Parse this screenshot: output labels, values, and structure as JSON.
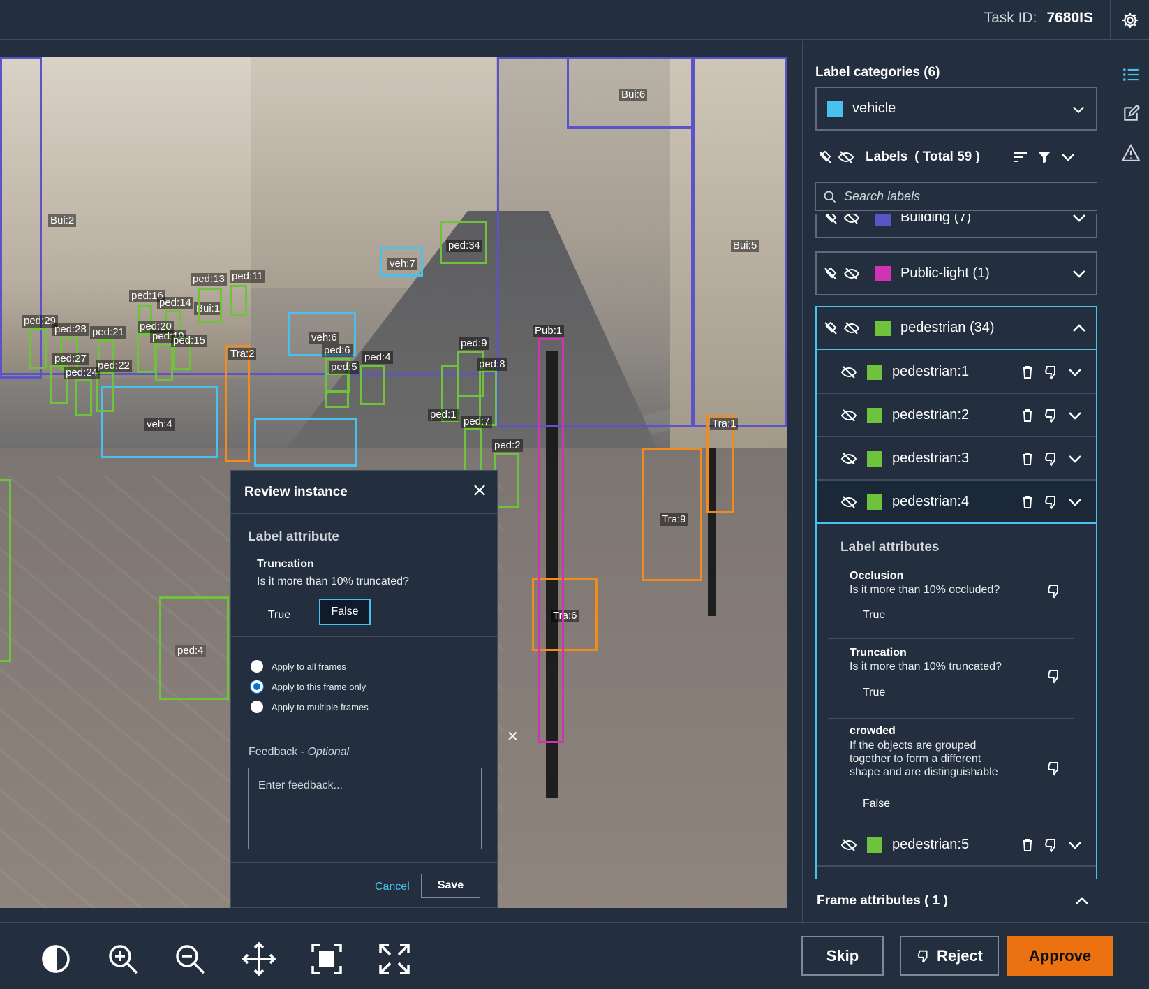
{
  "header": {
    "task_id_label": "Task ID:",
    "task_id_value": "7680IS"
  },
  "canvas": {
    "boxes": [
      {
        "label": "Bui:2"
      },
      {
        "label": "Bui:6"
      },
      {
        "label": "Bui:5"
      },
      {
        "label": "Bui:1"
      },
      {
        "label": "veh:7"
      },
      {
        "label": "veh:6"
      },
      {
        "label": "veh:4"
      },
      {
        "label": "ped:34"
      },
      {
        "label": "ped:13"
      },
      {
        "label": "ped:11"
      },
      {
        "label": "ped:16"
      },
      {
        "label": "ped:14"
      },
      {
        "label": "ped:29"
      },
      {
        "label": "ped:28"
      },
      {
        "label": "ped:21"
      },
      {
        "label": "ped:20"
      },
      {
        "label": "ped:19"
      },
      {
        "label": "ped:15"
      },
      {
        "label": "ped:27"
      },
      {
        "label": "ped:22"
      },
      {
        "label": "ped:24"
      },
      {
        "label": "ped:6"
      },
      {
        "label": "ped:5"
      },
      {
        "label": "ped:4"
      },
      {
        "label": "ped:9"
      },
      {
        "label": "ped:8"
      },
      {
        "label": "ped:1"
      },
      {
        "label": "ped:7"
      },
      {
        "label": "ped:2"
      },
      {
        "label": "Tra:2"
      },
      {
        "label": "Tra:1"
      },
      {
        "label": "Tra:9"
      },
      {
        "label": "Tra:6"
      },
      {
        "label": "Pub:1"
      },
      {
        "label": "ped:4"
      }
    ]
  },
  "review_dialog": {
    "title": "Review instance",
    "section_title": "Label attribute",
    "attribute_name": "Truncation",
    "attribute_question": "Is it more than 10% truncated?",
    "options": [
      "True",
      "False"
    ],
    "selected_option": "False",
    "apply_options": [
      "Apply to all frames",
      "Apply to this frame only",
      "Apply to multiple frames"
    ],
    "apply_selected": "Apply to this frame only",
    "feedback_label": "Feedback - ",
    "feedback_optional": "Optional",
    "feedback_placeholder": "Enter feedback...",
    "cancel": "Cancel",
    "save": "Save"
  },
  "right_panel": {
    "label_categories_title": "Label categories (6)",
    "category_selected": "vehicle",
    "labels_title": "Labels",
    "labels_total": "( Total 59 )",
    "search_placeholder": "Search labels",
    "categories": [
      {
        "name": "Building (7)",
        "color": "#5b54c8"
      },
      {
        "name": "Public-light (1)",
        "color": "#d233b4"
      },
      {
        "name": "pedestrian (34)",
        "color": "#6fc23b"
      }
    ],
    "instances": [
      "pedestrian:1",
      "pedestrian:2",
      "pedestrian:3",
      "pedestrian:4"
    ],
    "selected_instance": "pedestrian:4",
    "label_attributes_title": "Label attributes",
    "attributes": [
      {
        "name": "Occlusion",
        "question": "Is it more than 10% occluded?",
        "value": "True"
      },
      {
        "name": "Truncation",
        "question": "Is it more than 10% truncated?",
        "value": "True"
      },
      {
        "name": "crowded",
        "question": "If the objects are grouped together to form a different shape and are distinguishable",
        "value": "False"
      }
    ],
    "next_instance": "pedestrian:5",
    "frame_attributes_title": "Frame attributes ( 1 )"
  },
  "footer": {
    "skip": "Skip",
    "reject": "Reject",
    "approve": "Approve"
  },
  "colors": {
    "accent": "#48c1ee",
    "approve": "#ec7211",
    "vehicle": "#48c1ee",
    "pedestrian": "#6fc23b"
  }
}
